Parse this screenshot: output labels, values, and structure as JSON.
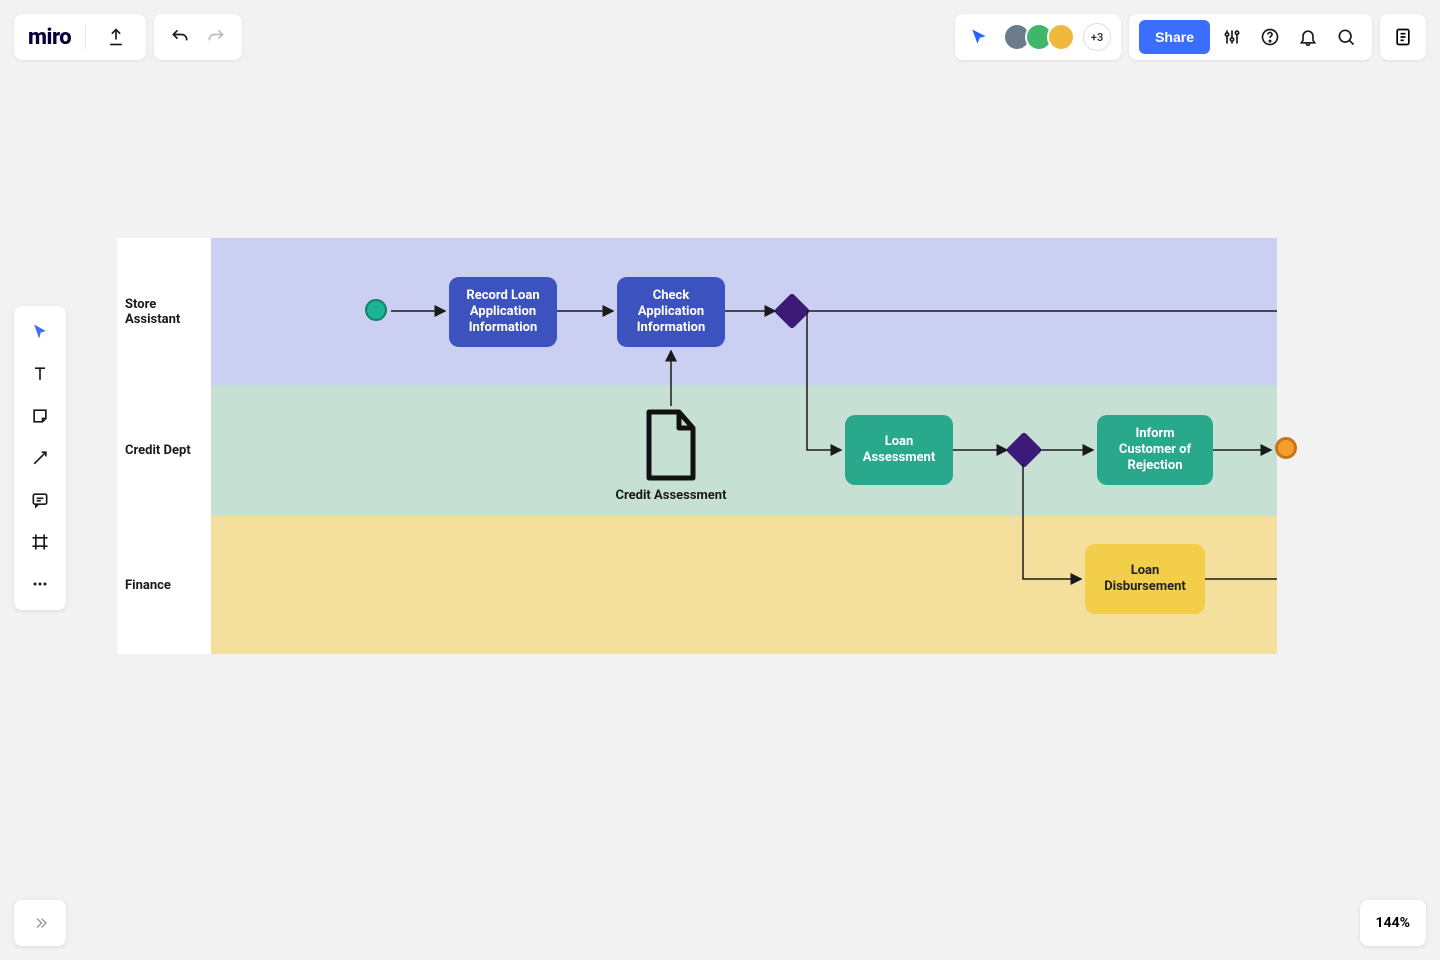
{
  "app": {
    "logo": "miro"
  },
  "collab": {
    "overflow": "+3"
  },
  "share": {
    "label": "Share"
  },
  "zoom": {
    "value": "144%"
  },
  "lanes": {
    "l1": "Store Assistant",
    "l2": "Credit Dept",
    "l3": "Finance"
  },
  "tasks": {
    "record": "Record Loan Application Information",
    "check": "Check Application Information",
    "assess": "Loan Assessment",
    "reject": "Inform Customer of Rejection",
    "disburse": "Loan Disbursement"
  },
  "artifact": {
    "credit": "Credit Assessment"
  },
  "avatars": {
    "a1": "#6b7b8c",
    "a2": "#3eb76a",
    "a3": "#f0b83e"
  }
}
